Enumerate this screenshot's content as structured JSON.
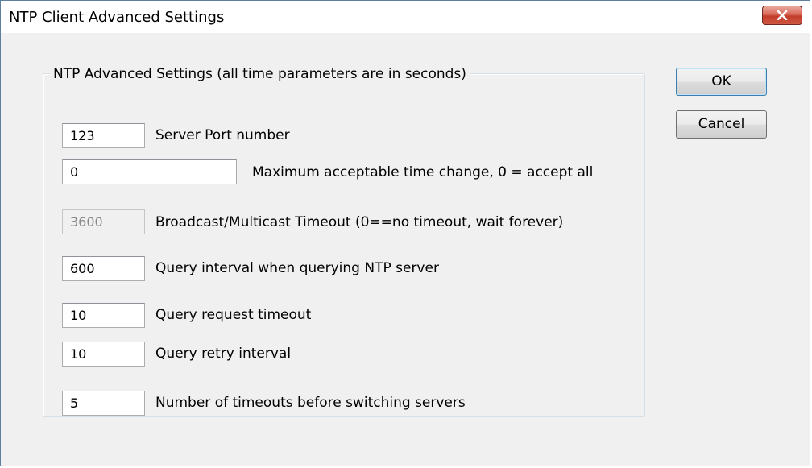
{
  "window": {
    "title": "NTP Client Advanced Settings"
  },
  "buttons": {
    "ok": "OK",
    "cancel": "Cancel"
  },
  "group": {
    "label": "NTP Advanced Settings (all time parameters are in seconds)",
    "fields": [
      {
        "value": "123",
        "label": "Server Port number",
        "enabled": true
      },
      {
        "value": "0",
        "label": "Maximum acceptable time change, 0 = accept all",
        "enabled": true
      },
      {
        "value": "3600",
        "label": "Broadcast/Multicast Timeout (0==no timeout, wait forever)",
        "enabled": false
      },
      {
        "value": "600",
        "label": "Query interval when querying NTP server",
        "enabled": true
      },
      {
        "value": "10",
        "label": "Query request timeout",
        "enabled": true
      },
      {
        "value": "10",
        "label": "Query retry interval",
        "enabled": true
      },
      {
        "value": "5",
        "label": "Number of timeouts before switching servers",
        "enabled": true
      }
    ]
  },
  "icons": {
    "close": "close-icon"
  },
  "colors": {
    "close_button": "#c94a38",
    "dialog_bg": "#f0f0f0"
  }
}
